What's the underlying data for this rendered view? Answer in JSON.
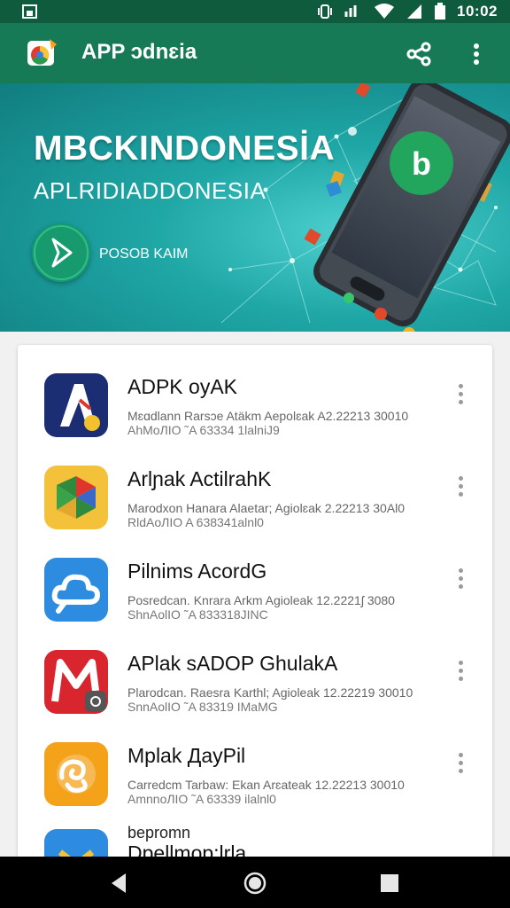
{
  "status_bar": {
    "time": "10:02"
  },
  "app_bar": {
    "title": "APP ɔdnɛia"
  },
  "banner": {
    "headline": "MBCKINDONESİA",
    "subheadline": "APLRIDIADDONESIA",
    "cta_label": "POSOB KAIM"
  },
  "apps": [
    {
      "name": "ADPK oyAK",
      "line1": "Mɛɑdlann  Rarsɔe Atäkm  Aepolɛak A2.22213 30010",
      "line2": "AhMoЛIO ˜A 63334 1lalniJ9"
    },
    {
      "name": "Arlɲak ActilrahK",
      "line1": "Marodxon  Hanara Alaetar;  Agiolɛak  2.22213 30Al0",
      "line2": "RldAoЛIO A 638341alnl0"
    },
    {
      "name": "Pilnims AcordG",
      "line1": "Posredcan. Knrara Arkm  Agioleak  12.2221ʃ 3080",
      "line2": "ShnAolIO ˜A 833318JINC"
    },
    {
      "name": "APlak sADOP GhulakA",
      "line1": "Plarodcan. Raesra Karthl;  Agioleak  12.22219 30010",
      "line2": "SnnAolIO ˜A 83319 IMaMG"
    },
    {
      "name": "Mplak ДayPil",
      "line1": "Carredcm  Tarbaw: Ekan  Arɛateak  12.22213 30010",
      "line2": "AmnnoЛIO ˜A 63339 ilalnl0"
    },
    {
      "top_label": "bepromn",
      "name": "Dpellmop:lrla"
    }
  ]
}
